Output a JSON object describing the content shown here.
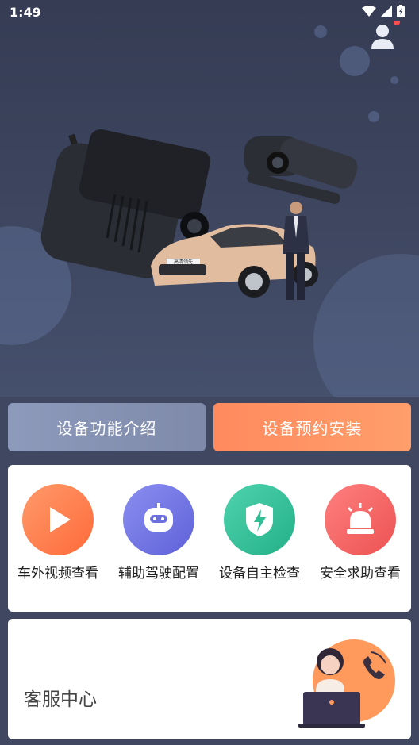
{
  "status_bar": {
    "time": "1:49"
  },
  "actions": {
    "intro_label": "设备功能介绍",
    "install_label": "设备预约安装"
  },
  "features": [
    {
      "label": "车外视频查看",
      "icon": "play-icon",
      "color": "#ff7a45"
    },
    {
      "label": "辅助驾驶配置",
      "icon": "robot-icon",
      "color": "#6b6fe0"
    },
    {
      "label": "设备自主检查",
      "icon": "shield-bolt-icon",
      "color": "#2fbf95"
    },
    {
      "label": "安全求助查看",
      "icon": "alarm-light-icon",
      "color": "#f05d5d"
    }
  ],
  "service": {
    "title": "客服中心"
  },
  "hero_badge": "高清领先"
}
